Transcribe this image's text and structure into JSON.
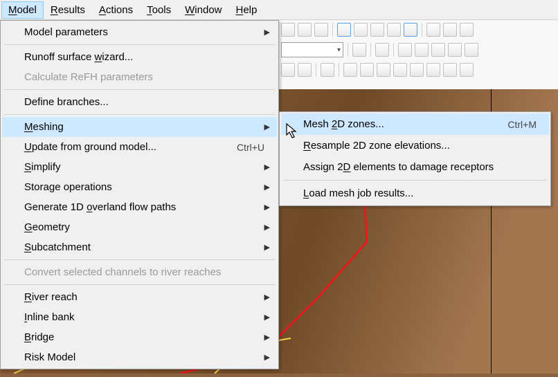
{
  "menubar": {
    "items": [
      {
        "label": "Model",
        "accel": "M",
        "open": true
      },
      {
        "label": "Results",
        "accel": "R"
      },
      {
        "label": "Actions",
        "accel": "A"
      },
      {
        "label": "Tools",
        "accel": "T"
      },
      {
        "label": "Window",
        "accel": "W"
      },
      {
        "label": "Help",
        "accel": "H"
      }
    ]
  },
  "model_menu": {
    "items": [
      {
        "label": "Model parameters",
        "submenu": true
      },
      {
        "sep": true
      },
      {
        "label": "Runoff surface wizard...",
        "accel": "W"
      },
      {
        "label": "Calculate ReFH parameters",
        "disabled": true
      },
      {
        "sep": true
      },
      {
        "label": "Define branches..."
      },
      {
        "sep": true
      },
      {
        "label": "Meshing",
        "submenu": true,
        "hover": true,
        "accel": "M"
      },
      {
        "label": "Update from ground model...",
        "accel": "U",
        "shortcut": "Ctrl+U"
      },
      {
        "label": "Simplify",
        "submenu": true,
        "accel": "S"
      },
      {
        "label": "Storage operations",
        "submenu": true
      },
      {
        "label": "Generate 1D overland flow paths",
        "submenu": true,
        "accel": "o"
      },
      {
        "label": "Geometry",
        "submenu": true,
        "accel": "G"
      },
      {
        "label": "Subcatchment",
        "submenu": true,
        "accel": "S"
      },
      {
        "sep": true
      },
      {
        "label": "Convert selected channels to river reaches",
        "disabled": true
      },
      {
        "sep": true
      },
      {
        "label": "River reach",
        "submenu": true,
        "accel": "R"
      },
      {
        "label": "Inline bank",
        "submenu": true,
        "accel": "I"
      },
      {
        "label": "Bridge",
        "submenu": true,
        "accel": "B"
      },
      {
        "label": "Risk Model",
        "submenu": true
      }
    ]
  },
  "meshing_submenu": {
    "items": [
      {
        "label": "Mesh 2D zones...",
        "accel": "2",
        "shortcut": "Ctrl+M",
        "hover": true
      },
      {
        "label": "Resample 2D zone elevations...",
        "accel": "R"
      },
      {
        "label": "Assign 2D elements to damage receptors",
        "accel": "d"
      },
      {
        "sep": true
      },
      {
        "label": "Load mesh job results...",
        "accel": "L"
      }
    ]
  },
  "colors": {
    "highlight": "#cde8ff",
    "menu_bg": "#f0f0f0",
    "map_line_red": "#e31b1b",
    "map_line_yellow": "#f7d24a"
  }
}
